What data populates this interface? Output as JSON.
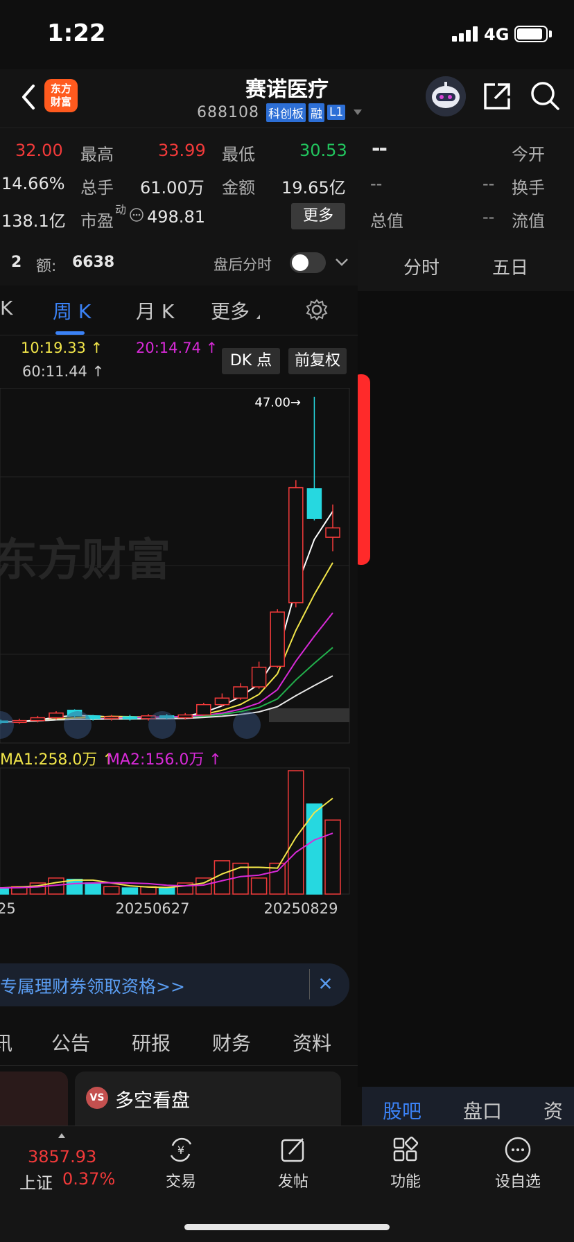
{
  "status_bar": {
    "time": "1:22",
    "network": "4G"
  },
  "header": {
    "logo_text": "东方财富",
    "name": "赛诺医疗",
    "code": "688108",
    "tags": [
      "科创板",
      "融",
      "L1"
    ]
  },
  "quote": {
    "price_partial": "32.00",
    "high_label": "最高",
    "high_value": "33.99",
    "low_label": "最低",
    "low_value": "30.53",
    "right_top": "--",
    "open_label": "今开",
    "turnover_partial": "14.66%",
    "volume_label": "总手",
    "volume_value": "61.00万",
    "amount_label": "金额",
    "amount_value": "19.65亿",
    "dash1": "--",
    "dash2": "--",
    "turnrate_label": "换手",
    "mktcap_partial": "138.1亿",
    "pe_label": "市盈",
    "pe_sup": "动",
    "pe_value": "498.81",
    "more_button": "更多",
    "total_value_label": "总值",
    "dash3": "--",
    "float_value_label": "流值"
  },
  "chart_panel": {
    "vol_num": "2",
    "amount_label": "额:",
    "amount_value": "6638",
    "after_hours_label": "盘后分时",
    "period_tabs": [
      "K",
      "周 K",
      "月 K",
      "更多"
    ],
    "ma_labels": {
      "ma10": "10:19.33 ↑",
      "ma20": "20:14.74 ↑",
      "ma60": "60:11.44 ↑"
    },
    "dk_button": "DK 点",
    "fq_button": "前复权",
    "watermark": "东方财富",
    "vol_ma_labels": {
      "ma1": "MA1:258.0万 ↑",
      "ma2": "MA2:156.0万 ↑"
    },
    "banner_text": "专属理财券领取资格>>",
    "info_tabs": [
      "讯",
      "公告",
      "研报",
      "财务",
      "资料"
    ],
    "vs_card_label": "多空看盘"
  },
  "right_pane": {
    "tabs": [
      "分时",
      "五日"
    ],
    "bottom_tabs": [
      "股吧",
      "盘口",
      "资讯"
    ]
  },
  "colors": {
    "up": "#f23a3a",
    "down": "#26d8e0",
    "accent": "#3b82f6",
    "ma10": "#f2e64a",
    "ma20": "#d82ad8",
    "ma60": "#e8e8e8"
  },
  "chart_data": {
    "type": "candlestick",
    "period": "weekly",
    "x_tick_labels": [
      "25",
      "20250627",
      "20250829"
    ],
    "high_annotation": "47.00",
    "candles": [
      {
        "open": 12.4,
        "close": 12.3,
        "high": 12.6,
        "low": 12.1
      },
      {
        "open": 12.3,
        "close": 12.2,
        "high": 12.5,
        "low": 12.0
      },
      {
        "open": 12.2,
        "close": 12.35,
        "high": 12.5,
        "low": 12.0
      },
      {
        "open": 12.35,
        "close": 12.2,
        "high": 12.5,
        "low": 12.0
      },
      {
        "open": 12.2,
        "close": 12.4,
        "high": 12.6,
        "low": 12.05
      },
      {
        "open": 12.4,
        "close": 12.7,
        "high": 12.9,
        "low": 12.2
      },
      {
        "open": 12.7,
        "close": 13.2,
        "high": 13.4,
        "low": 12.5
      },
      {
        "open": 13.5,
        "close": 12.9,
        "high": 13.6,
        "low": 12.7
      },
      {
        "open": 12.9,
        "close": 12.6,
        "high": 13.0,
        "low": 12.4
      },
      {
        "open": 12.6,
        "close": 12.8,
        "high": 13.0,
        "low": 12.4
      },
      {
        "open": 12.8,
        "close": 12.6,
        "high": 13.0,
        "low": 12.4
      },
      {
        "open": 12.6,
        "close": 12.9,
        "high": 13.1,
        "low": 12.4
      },
      {
        "open": 12.9,
        "close": 12.7,
        "high": 13.1,
        "low": 12.5
      },
      {
        "open": 12.7,
        "close": 13.0,
        "high": 13.2,
        "low": 12.5
      },
      {
        "open": 13.0,
        "close": 14.1,
        "high": 14.3,
        "low": 12.9
      },
      {
        "open": 14.1,
        "close": 14.8,
        "high": 15.3,
        "low": 13.9
      },
      {
        "open": 14.8,
        "close": 16.0,
        "high": 16.4,
        "low": 14.6
      },
      {
        "open": 16.0,
        "close": 18.1,
        "high": 18.7,
        "low": 15.8
      },
      {
        "open": 18.2,
        "close": 24.0,
        "high": 24.3,
        "low": 18.0
      },
      {
        "open": 25.0,
        "close": 37.3,
        "high": 38.1,
        "low": 24.5
      },
      {
        "open": 37.2,
        "close": 34.0,
        "high": 47.0,
        "low": 33.8
      },
      {
        "open": 32.0,
        "close": 33.0,
        "high": 35.5,
        "low": 30.5
      }
    ],
    "ma_lines": {
      "ma10_last": 19.33,
      "ma20_last": 14.74,
      "ma60_last": 11.44
    },
    "volumes": [
      5,
      4,
      6,
      5,
      6,
      9,
      13,
      12,
      9,
      6,
      5,
      6,
      5,
      9,
      13,
      27,
      25,
      13,
      25,
      100,
      73,
      60
    ],
    "volume_unit": "relative (% of max)"
  }
}
